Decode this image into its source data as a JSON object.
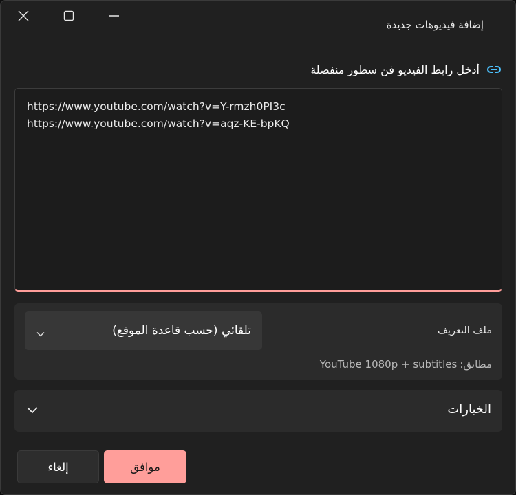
{
  "window": {
    "title": "إضافة فيديوهات جديدة"
  },
  "prompt": {
    "icon": "link-icon",
    "label": "أدخل رابط الفيديو فن سطور منفصلة"
  },
  "urls": {
    "lines": [
      "https://www.youtube.com/watch?v=Y-rmzh0PI3c",
      "https://www.youtube.com/watch?v=aqz-KE-bpKQ"
    ]
  },
  "profile": {
    "label": "ملف التعريف",
    "selected": "تلقائي (حسب قاعدة الموقع)",
    "match_prefix": "مطابق:",
    "match_value": "YouTube 1080p + subtitles"
  },
  "options": {
    "label": "الخيارات"
  },
  "footer": {
    "ok_label": "موافق",
    "cancel_label": "إلغاء"
  },
  "colors": {
    "accent": "#ff9e9a",
    "link_icon": "#4cc2ff",
    "background": "#202020",
    "card": "#2b2b2b"
  }
}
